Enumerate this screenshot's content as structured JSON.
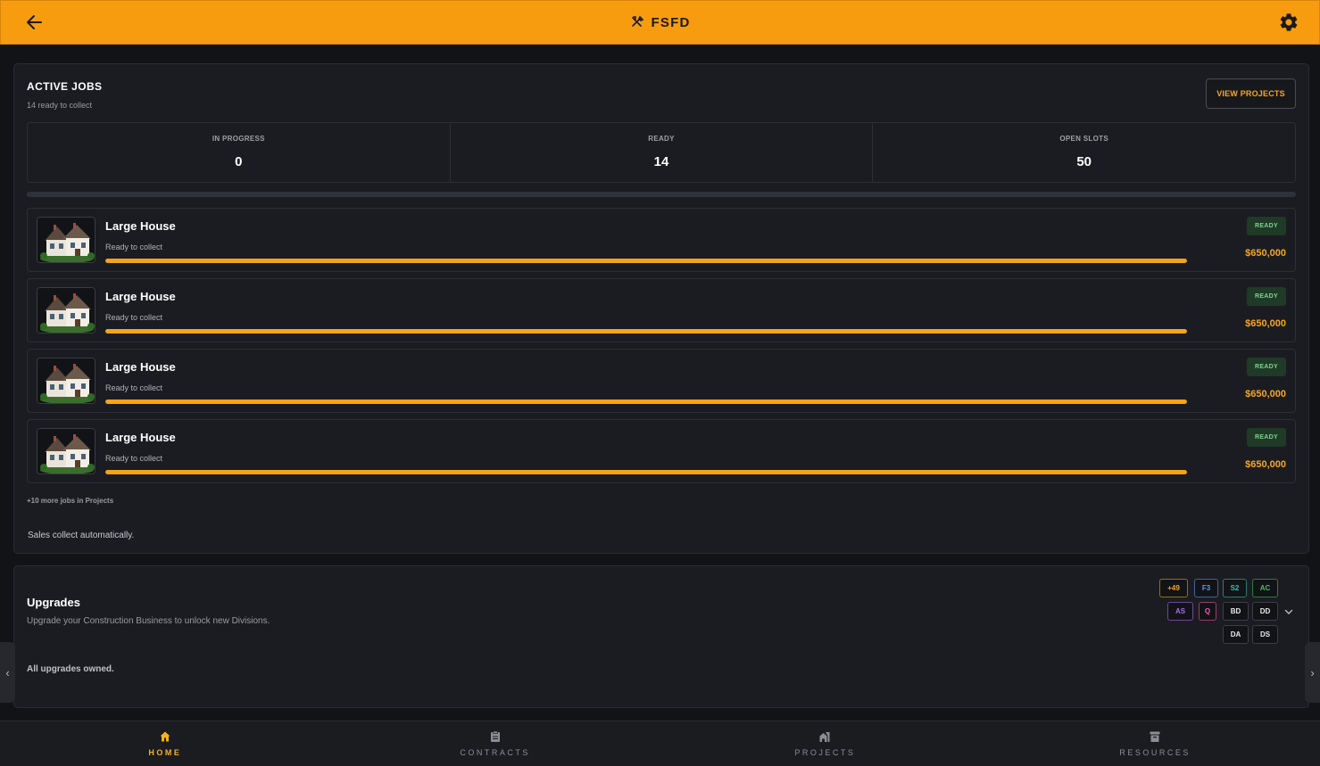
{
  "header": {
    "title": "FSFD",
    "back_icon": "arrow-left-icon",
    "settings_icon": "gear-icon",
    "title_icon": "hammer-wrench-icon",
    "bg_color": "#f89c0f"
  },
  "active_jobs": {
    "title": "ACTIVE JOBS",
    "subtitle": "14 ready to collect",
    "view_projects_label": "VIEW PROJECTS",
    "stats": [
      {
        "label": "IN PROGRESS",
        "value": "0"
      },
      {
        "label": "READY",
        "value": "14"
      },
      {
        "label": "OPEN SLOTS",
        "value": "50"
      }
    ],
    "jobs": [
      {
        "name": "Large House",
        "status": "Ready to collect",
        "badge": "READY",
        "price": "$650,000",
        "progress": 1.0
      },
      {
        "name": "Large House",
        "status": "Ready to collect",
        "badge": "READY",
        "price": "$650,000",
        "progress": 1.0
      },
      {
        "name": "Large House",
        "status": "Ready to collect",
        "badge": "READY",
        "price": "$650,000",
        "progress": 1.0
      },
      {
        "name": "Large House",
        "status": "Ready to collect",
        "badge": "READY",
        "price": "$650,000",
        "progress": 1.0
      }
    ],
    "more_jobs": "+10 more jobs in Projects",
    "auto_note": "Sales collect automatically."
  },
  "upgrades": {
    "title": "Upgrades",
    "description": "Upgrade your Construction Business to unlock new Divisions.",
    "owned_note": "All upgrades owned.",
    "chips": [
      {
        "label": "+49",
        "color": "#f6a623"
      },
      {
        "label": "F3",
        "color": "#5b9cf5"
      },
      {
        "label": "S2",
        "color": "#2ec4b6"
      },
      {
        "label": "AC",
        "color": "#3fbf6a"
      },
      {
        "label": "AS",
        "color": "#a66cf0"
      },
      {
        "label": "Q",
        "color": "#ef5da8"
      },
      {
        "label": "BD",
        "color": "#e8e8ea"
      },
      {
        "label": "DD",
        "color": "#e8e8ea"
      },
      {
        "label": "DA",
        "color": "#e8e8ea"
      },
      {
        "label": "DS",
        "color": "#e8e8ea"
      }
    ]
  },
  "side_nav": {
    "left": "‹",
    "right": "›"
  },
  "bottom_nav": [
    {
      "label": "HOME",
      "icon": "home-icon",
      "active": true
    },
    {
      "label": "CONTRACTS",
      "icon": "clipboard-icon",
      "active": false
    },
    {
      "label": "PROJECTS",
      "icon": "buildings-icon",
      "active": false
    },
    {
      "label": "RESOURCES",
      "icon": "archive-box-icon",
      "active": false
    }
  ],
  "accent_color": "#f6a623"
}
